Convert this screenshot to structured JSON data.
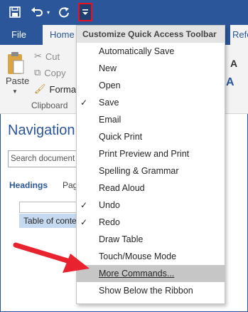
{
  "title_bar": {
    "qat_icons": [
      "save-icon",
      "undo-icon",
      "redo-icon",
      "customize-qat-icon"
    ]
  },
  "tabs": [
    {
      "label": "File"
    },
    {
      "label": "Home"
    },
    {
      "label": "Refer"
    }
  ],
  "ribbon": {
    "paste_label": "Paste",
    "cut_label": "Cut",
    "copy_label": "Copy",
    "format_label": "Format",
    "group_label": "Clipboard",
    "right_a": "A",
    "right_b": "A"
  },
  "navigation": {
    "title": "Navigation",
    "search_placeholder": "Search document",
    "tab_headings": "Headings",
    "tab_pages": "Pag",
    "toc_item": "Table of conte"
  },
  "menu": {
    "header": "Customize Quick Access Toolbar",
    "items": [
      {
        "label": "Automatically Save",
        "checked": false
      },
      {
        "label": "New",
        "checked": false
      },
      {
        "label": "Open",
        "checked": false
      },
      {
        "label": "Save",
        "checked": true
      },
      {
        "label": "Email",
        "checked": false
      },
      {
        "label": "Quick Print",
        "checked": false
      },
      {
        "label": "Print Preview and Print",
        "checked": false
      },
      {
        "label": "Spelling & Grammar",
        "checked": false
      },
      {
        "label": "Read Aloud",
        "checked": false
      },
      {
        "label": "Undo",
        "checked": true
      },
      {
        "label": "Redo",
        "checked": true
      },
      {
        "label": "Draw Table",
        "checked": false
      },
      {
        "label": "Touch/Mouse Mode",
        "checked": false
      },
      {
        "label": "More Commands...",
        "checked": false,
        "highlighted": true
      },
      {
        "label": "Show Below the Ribbon",
        "checked": false
      }
    ],
    "check_glyph": "✓"
  },
  "colors": {
    "word_blue": "#2b579a",
    "highlight_box": "#e81123",
    "arrow": "#e8232f"
  }
}
